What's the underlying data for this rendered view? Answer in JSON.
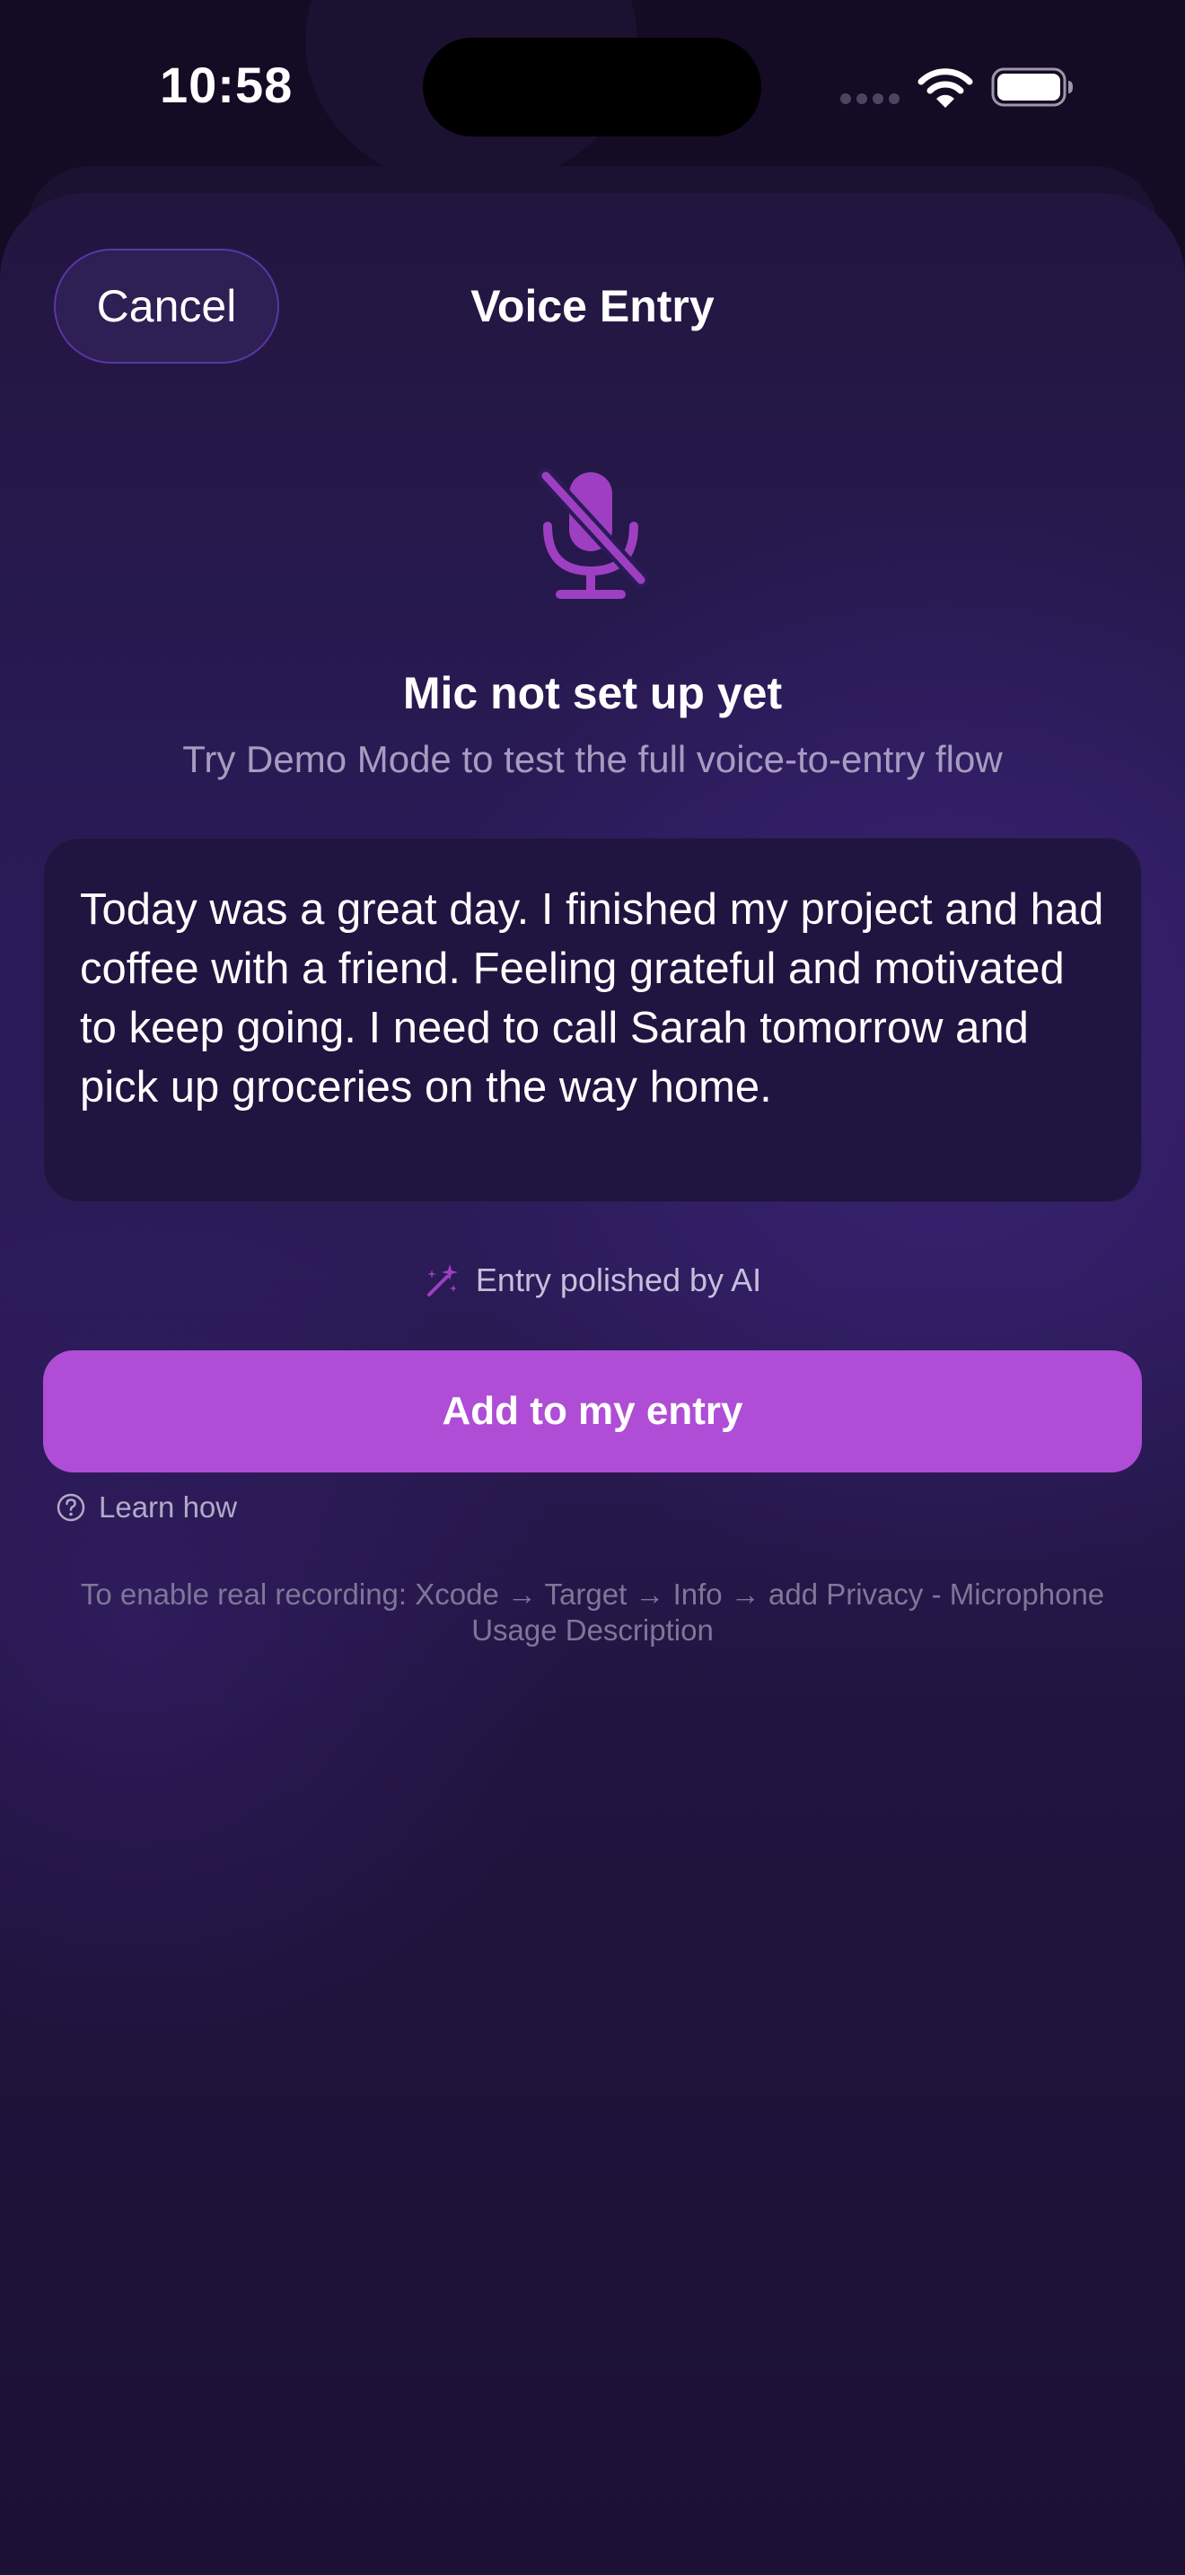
{
  "status_bar": {
    "time": "10:58"
  },
  "sheet": {
    "title": "Voice Entry",
    "cancel_label": "Cancel"
  },
  "mic_status": {
    "icon": "mic-off-icon",
    "title": "Mic not set up yet",
    "subtitle": "Try Demo Mode to test the full voice-to-entry flow"
  },
  "transcript": {
    "text": "Today was a great day. I finished my project and had coffee with a friend. Feeling grateful and motivated to keep going. I need to call Sarah tomorrow and pick up groceries on the way home."
  },
  "ai_note": {
    "icon": "sparkles-icon",
    "label": "Entry polished by AI"
  },
  "primary_action": {
    "label": "Add to my entry"
  },
  "learn_how": {
    "icon": "question-circle-icon",
    "label": "Learn how"
  },
  "setup_hint": {
    "text": "To enable real recording: Xcode → Target → Info → add Privacy - Microphone Usage Description"
  },
  "colors": {
    "accent": "#af4dd6",
    "icon_purple": "#9e3fc2",
    "background": "#2a1b58",
    "card": "#1f1540"
  }
}
